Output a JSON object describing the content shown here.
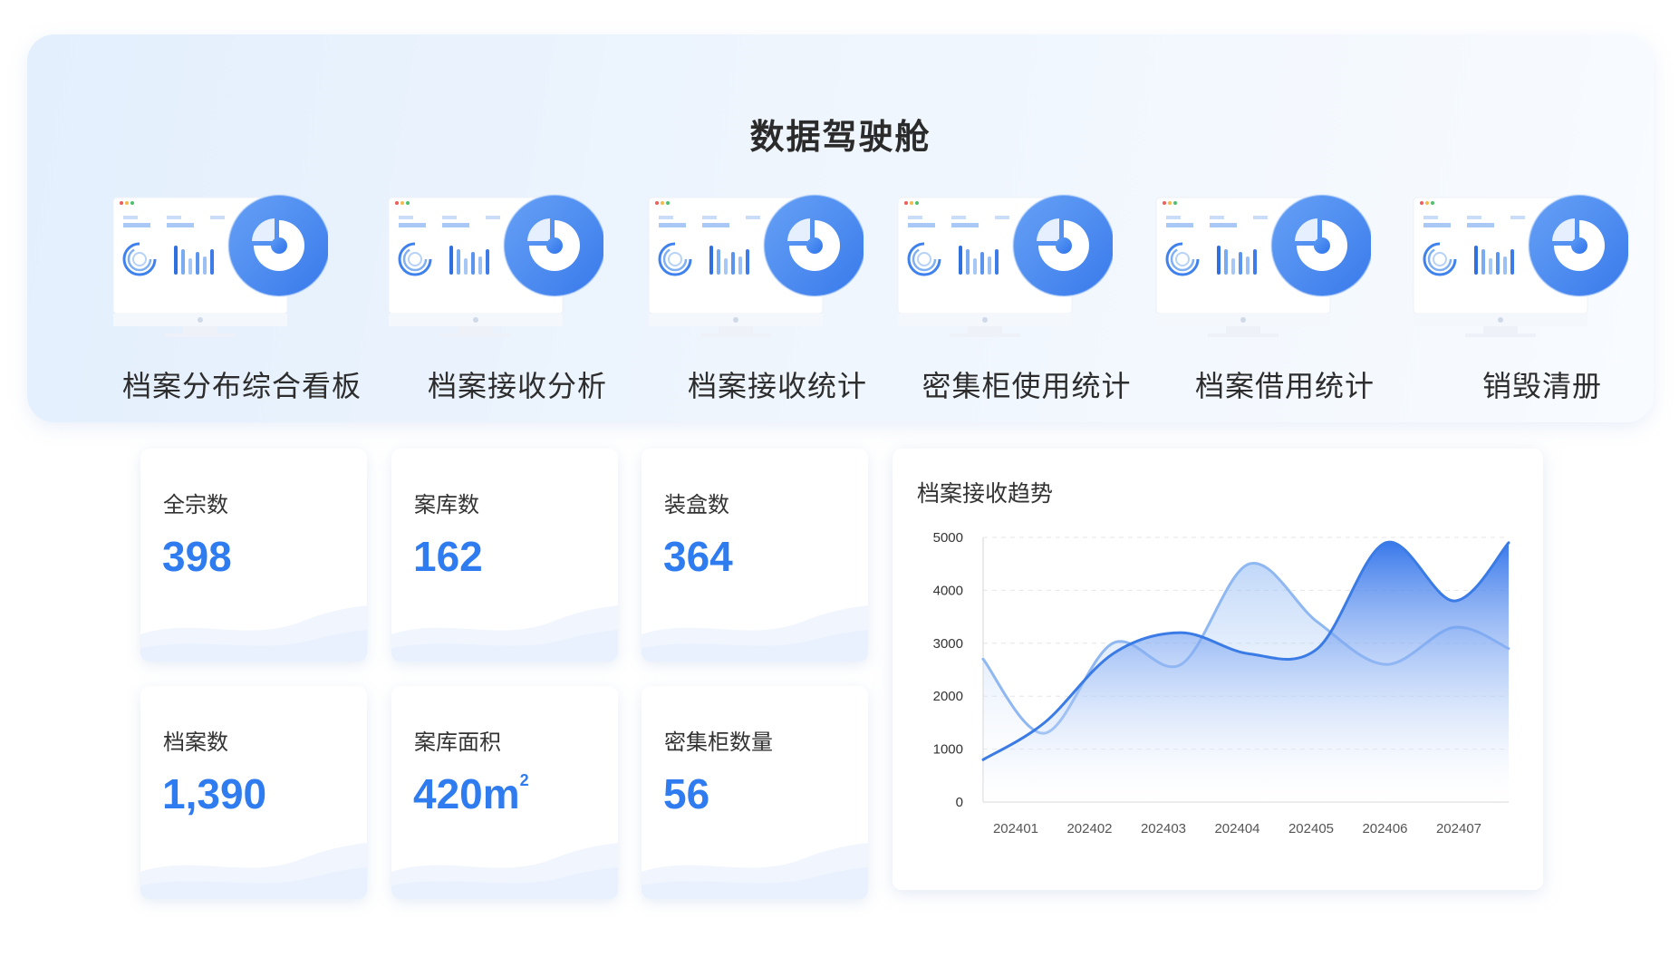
{
  "dashboard": {
    "title": "数据驾驶舱",
    "modules": [
      {
        "label": "档案分布综合看板",
        "icon": "monitor-pie-icon"
      },
      {
        "label": "档案接收分析",
        "icon": "monitor-pie-icon"
      },
      {
        "label": "档案接收统计",
        "icon": "monitor-pie-icon"
      },
      {
        "label": "密集柜使用统计",
        "icon": "monitor-pie-icon"
      },
      {
        "label": "档案借用统计",
        "icon": "monitor-pie-icon"
      },
      {
        "label": "销毁清册",
        "icon": "monitor-pie-icon"
      }
    ]
  },
  "stats": [
    {
      "label": "全宗数",
      "value": "398"
    },
    {
      "label": "案库数",
      "value": "162"
    },
    {
      "label": "装盒数",
      "value": "364"
    },
    {
      "label": "档案数",
      "value": "1,390"
    },
    {
      "label": "案库面积",
      "value": "420m",
      "unit_sup": "2"
    },
    {
      "label": "密集柜数量",
      "value": "56"
    }
  ],
  "trend": {
    "title": "档案接收趋势"
  },
  "colors": {
    "accent": "#2e7cf0",
    "series_dark": "#3a7be6",
    "series_light": "#8fb8f2"
  },
  "chart_data": {
    "type": "area",
    "title": "档案接收趋势",
    "x": [
      "202401",
      "202402",
      "202403",
      "202404",
      "202405",
      "202406",
      "202407"
    ],
    "ylim": [
      0,
      5000
    ],
    "yticks": [
      "0",
      "1000",
      "2000",
      "3000",
      "4000",
      "5000"
    ],
    "grid": true,
    "series": [
      {
        "values": [
          800,
          1500,
          2800,
          3200,
          2800,
          2900,
          4900,
          3800,
          4900
        ]
      },
      {
        "values": [
          2700,
          1300,
          3000,
          2600,
          4500,
          3400,
          2600,
          3300,
          2900
        ]
      }
    ],
    "series_x": [
      0.0,
      0.9,
      1.9,
      2.9,
      3.9,
      4.9,
      5.9,
      6.9,
      7.7
    ]
  }
}
